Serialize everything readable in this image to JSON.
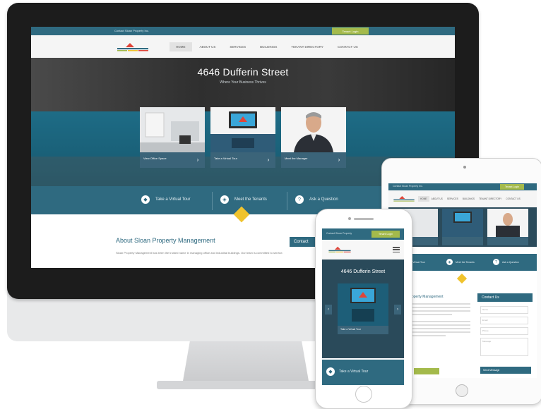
{
  "colors": {
    "teal": "#2f6a80",
    "green_button": "#a4ba4b",
    "accent_yellow": "#f0c32d"
  },
  "desktop": {
    "topbar_text": "Contact Sloan Property Inc.",
    "login_label": "Tenant Login",
    "nav": [
      "Home",
      "About Us",
      "Services",
      "Buildings",
      "Tenant Directory",
      "Contact Us"
    ],
    "hero_title": "4646 Dufferin Street",
    "hero_subtitle": "Where Your Business Thrives",
    "cards": [
      {
        "caption": "View Office Space",
        "icon": "office-photo"
      },
      {
        "caption": "Take a Virtual Tour",
        "icon": "tv-photo"
      },
      {
        "caption": "Meet the Manager",
        "icon": "portrait-photo"
      }
    ],
    "features": [
      {
        "label": "Take a Virtual Tour",
        "icon": "chat-icon"
      },
      {
        "label": "Meet the Tenants",
        "icon": "shield-icon"
      },
      {
        "label": "Ask a Question",
        "icon": "question-icon"
      }
    ],
    "about_title": "About Sloan Property Management",
    "about_text": "Sloan Property Management has been the trusted name in managing office and industrial buildings. Our team is committed to service.",
    "contact_label": "Contact"
  },
  "tablet": {
    "topbar_text": "Contact Sloan Property Inc.",
    "login_label": "Tenant Login",
    "nav": [
      "Home",
      "About Us",
      "Services",
      "Buildings",
      "Tenant Directory",
      "Contact Us"
    ],
    "features": [
      "Take a Virtual Tour",
      "Meet the Tenants",
      "Ask a Question"
    ],
    "about_title": "Property Management",
    "contact_title": "Contact Us",
    "form_fields": [
      "Name",
      "Email",
      "Phone",
      "Message"
    ],
    "submit_label": "Send Message"
  },
  "phone": {
    "topbar_text": "Contact Sloan Property",
    "login_label": "Tenant Login",
    "hero_title": "4646 Dufferin Street",
    "card_caption": "Take a Virtual Tour",
    "feature_label": "Take a Virtual Tour"
  }
}
